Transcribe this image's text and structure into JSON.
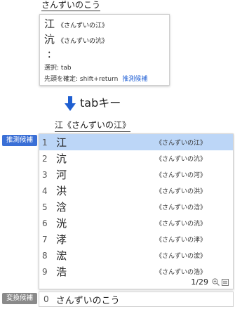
{
  "top": {
    "reading": "さんずいのこう",
    "mini_candidates": [
      {
        "kanji": "江",
        "anno": "《さんずいの江》"
      },
      {
        "kanji": "沆",
        "anno": "《さんずいの沆》"
      }
    ],
    "ellipsis": "：",
    "select_info": "選択: tab",
    "confirm_info": "先頭を確定: shift+return",
    "predict_link": "推測候補"
  },
  "transition": {
    "key_label": "tabキー",
    "arrow_color": "#1f5fd1"
  },
  "composed_text": "江《さんずいの江》",
  "candidate_panel": {
    "badge": "推測候補",
    "selected_index": 0,
    "items": [
      {
        "num": "1",
        "kanji": "江",
        "anno": "《さんずいの江》"
      },
      {
        "num": "2",
        "kanji": "沆",
        "anno": "《さんずいの沆》"
      },
      {
        "num": "3",
        "kanji": "河",
        "anno": "《さんずいの河》"
      },
      {
        "num": "4",
        "kanji": "洪",
        "anno": "《さんずいの洪》"
      },
      {
        "num": "5",
        "kanji": "浛",
        "anno": "《さんずいの浛》"
      },
      {
        "num": "6",
        "kanji": "洸",
        "anno": "《さんずいの洸》"
      },
      {
        "num": "7",
        "kanji": "涍",
        "anno": "《さんずいの涍》"
      },
      {
        "num": "8",
        "kanji": "浤",
        "anno": "《さんずいの浤》"
      },
      {
        "num": "9",
        "kanji": "浩",
        "anno": "《さんずいの浩》"
      }
    ],
    "page": "1/29"
  },
  "conversion": {
    "badge": "変換候補",
    "num": "0",
    "text": "さんずいのこう"
  }
}
